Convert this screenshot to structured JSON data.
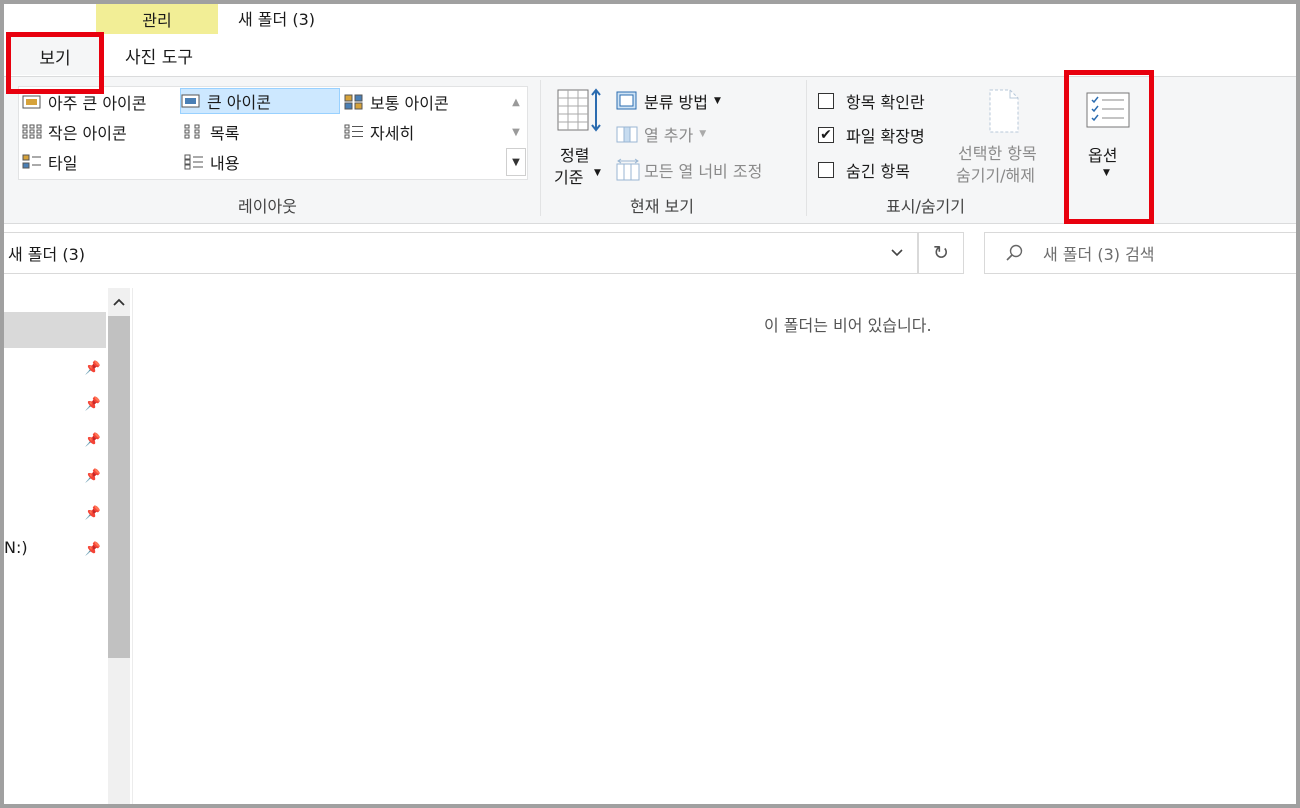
{
  "window": {
    "title": "새 폴더 (3)"
  },
  "ribbon_tabs": {
    "context_group": "관리",
    "view": "보기",
    "photo_tools": "사진 도구"
  },
  "layout": {
    "items": [
      "아주 큰 아이콘",
      "큰 아이콘",
      "보통 아이콘",
      "작은 아이콘",
      "목록",
      "자세히",
      "타일",
      "내용"
    ],
    "selected": "큰 아이콘",
    "group_label": "레이아웃"
  },
  "current_view": {
    "sort_by_line1": "정렬",
    "sort_by_line2": "기준",
    "group_by": "분류 방법",
    "add_columns": "열 추가",
    "size_all_columns": "모든 열 너비 조정",
    "group_label": "현재 보기"
  },
  "show_hide": {
    "item_checkboxes": {
      "label": "항목 확인란",
      "checked": false
    },
    "file_name_extensions": {
      "label": "파일 확장명",
      "checked": true
    },
    "hidden_items": {
      "label": "숨긴 항목",
      "checked": false
    },
    "hide_selected_line1": "선택한 항목",
    "hide_selected_line2": "숨기기/해제",
    "group_label": "표시/숨기기"
  },
  "options": {
    "label": "옵션"
  },
  "address": {
    "path": "새 폴더 (3)"
  },
  "search": {
    "placeholder": "새 폴더 (3) 검색"
  },
  "nav_pane": {
    "drive_label": "N:)"
  },
  "content": {
    "empty_message": "이 폴더는 비어 있습니다."
  },
  "colors": {
    "highlight": "#e8000e",
    "context_tab": "#f2ee96",
    "selected_item": "#cde8ff"
  }
}
